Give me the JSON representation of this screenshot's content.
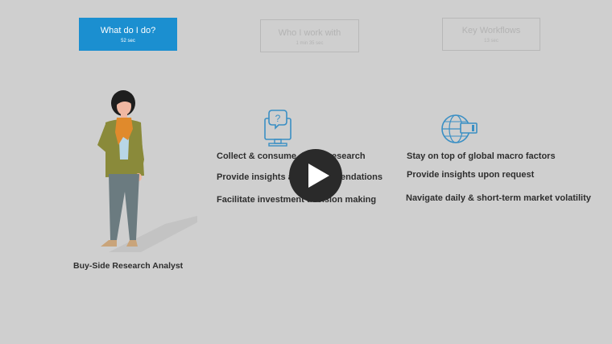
{
  "tabs": [
    {
      "label": "What do I do?",
      "duration": "52 sec",
      "active": true
    },
    {
      "label": "Who I work with",
      "duration": "1 min 35 sec",
      "active": false
    },
    {
      "label": "Key Workflows",
      "duration": "13 sec",
      "active": false
    }
  ],
  "persona": {
    "label": "Buy-Side Research Analyst"
  },
  "left_column": {
    "icon": "computer-question-icon",
    "items": [
      "Collect & consume data & research",
      "Provide insights and recommendations",
      "Facilitate investment decision making"
    ]
  },
  "right_column": {
    "icon": "globe-screen-icon",
    "items": [
      "Stay on top of global macro factors",
      "Provide insights upon request",
      "Navigate daily & short-term market volatility"
    ]
  },
  "video": {
    "play_icon": "play-icon"
  },
  "colors": {
    "accent": "#1b8fd0",
    "background": "#cfcfcf",
    "icon_blue": "#3a8fc4"
  }
}
